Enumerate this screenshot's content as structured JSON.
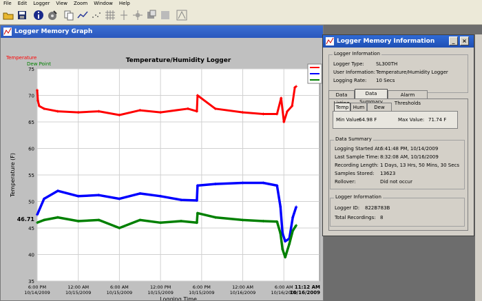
{
  "menu": [
    "File",
    "Edit",
    "Logger",
    "View",
    "Zoom",
    "Window",
    "Help"
  ],
  "toolbar_icons": [
    "open-icon",
    "save-icon",
    "info-icon",
    "settings-icon",
    "copy-icon",
    "line-icon",
    "scatter-icon",
    "grid-icon",
    "y-crosshair-icon",
    "cursor-icon",
    "fill-icon",
    "blank-icon",
    "expand-icon"
  ],
  "graph_window": {
    "title": "Logger Memory Graph",
    "chart_title": "Temperature/Humidity Logger",
    "legend": {
      "temperature": "Temperature",
      "dew_point": "Dew Point"
    },
    "ylabel": "Temperature (F)",
    "xlabel": "Logging Time",
    "y_ticks": [
      "75",
      "70",
      "65",
      "60",
      "55",
      "50",
      "45",
      "40",
      "35"
    ],
    "cursor_value": "46.71",
    "right_axis_bottom": "30",
    "x_ticks": [
      {
        "time": "6:00 PM",
        "date": "10/14/2009"
      },
      {
        "time": "12:00 AM",
        "date": "10/15/2009"
      },
      {
        "time": "6:00 AM",
        "date": "10/15/2009"
      },
      {
        "time": "12:00 PM",
        "date": "10/15/2009"
      },
      {
        "time": "6:00 PM",
        "date": "10/15/2009"
      },
      {
        "time": "12:00 AM",
        "date": "10/16/2009"
      },
      {
        "time": "6:00 AM",
        "date": "10/16/2009"
      }
    ],
    "x_end": {
      "time": "11:12 AM",
      "date": "10/16/2009"
    },
    "colors": {
      "temperature": "#ff0000",
      "humidity": "#0000ff",
      "dew_point": "#008000"
    }
  },
  "memory_window": {
    "title": "Logger Memory Information",
    "logger_info": {
      "heading": "Logger Information",
      "type_label": "Logger Type:",
      "type_value": "SL300TH",
      "user_label": "User Information:",
      "user_value": "Temperature/Humidity Logger",
      "rate_label": "Logging Rate:",
      "rate_value": "10 Secs"
    },
    "tabs": [
      "Data Listing",
      "Data Summary",
      "Alarm Thresholds"
    ],
    "subtabs": [
      "Temp",
      "Hum",
      "Dew Point"
    ],
    "min_label": "Min Value:",
    "min_value": "64.98 F",
    "max_label": "Max Value:",
    "max_value": "71.74 F",
    "data_summary": {
      "heading": "Data Summary",
      "started_label": "Logging Started At:",
      "started_value": "6:41:48 PM, 10/14/2009",
      "last_label": "Last Sample Time:",
      "last_value": "8:32:08 AM, 10/16/2009",
      "length_label": "Recording Length:",
      "length_value": "1 Days, 13 Hrs, 50 Mins, 30 Secs",
      "stored_label": "Samples Stored:",
      "stored_value": "13623",
      "rollover_label": "Rollover:",
      "rollover_value": "Did not occur"
    },
    "logger_info2": {
      "heading": "Logger Information",
      "id_label": "Logger ID:",
      "id_value": "822B783B",
      "rec_label": "Total Recordings:",
      "rec_value": "8"
    }
  },
  "chart_data": {
    "type": "line",
    "title": "Temperature/Humidity Logger",
    "xlabel": "Logging Time",
    "ylabel": "Temperature (F)",
    "ylim": [
      35,
      75
    ],
    "x_hours_categories": [
      "6:00 PM 10/14/2009",
      "12:00 AM 10/15/2009",
      "6:00 AM 10/15/2009",
      "12:00 PM 10/15/2009",
      "6:00 PM 10/15/2009",
      "12:00 AM 10/16/2009",
      "6:00 AM 10/16/2009",
      "11:12 AM 10/16/2009"
    ],
    "series": [
      {
        "name": "Temperature",
        "color": "#ff0000",
        "x": [
          0.0,
          0.1,
          0.3,
          1,
          3,
          6,
          9,
          12,
          15,
          18,
          22,
          23.3,
          23.4,
          26,
          30,
          33,
          35,
          35.6,
          36,
          36.5,
          37.2,
          37.6,
          37.8
        ],
        "y": [
          71.0,
          69.0,
          68.0,
          67.5,
          67.0,
          66.8,
          67.0,
          66.3,
          67.2,
          66.8,
          67.5,
          67.0,
          70.0,
          67.5,
          66.8,
          66.5,
          66.5,
          69.5,
          65.0,
          67.0,
          68.0,
          71.5,
          71.7
        ]
      },
      {
        "name": "Humidity",
        "color": "#0000ff",
        "x": [
          0.0,
          1,
          3,
          6,
          9,
          12,
          15,
          18,
          21,
          23.3,
          23.4,
          26,
          30,
          33,
          35,
          35.5,
          35.8,
          36.2,
          36.8,
          37.3,
          37.8
        ],
        "y": [
          47.5,
          50.5,
          52.0,
          51.0,
          51.2,
          50.5,
          51.5,
          51.0,
          50.3,
          50.2,
          53.0,
          53.3,
          53.5,
          53.5,
          53.0,
          49.0,
          44.0,
          42.5,
          43.0,
          47.0,
          49.0
        ]
      },
      {
        "name": "Dew Point",
        "color": "#008000",
        "x": [
          0.0,
          1,
          3,
          6,
          9,
          12,
          15,
          18,
          21,
          23.3,
          23.4,
          26,
          30,
          33,
          35,
          35.5,
          35.8,
          36.2,
          36.8,
          37.3,
          37.8
        ],
        "y": [
          46.0,
          46.5,
          47.0,
          46.3,
          46.5,
          45.0,
          46.5,
          46.0,
          46.3,
          46.0,
          47.8,
          47.0,
          46.5,
          46.3,
          46.2,
          44.0,
          41.0,
          39.5,
          42.0,
          44.5,
          45.5
        ]
      }
    ]
  }
}
